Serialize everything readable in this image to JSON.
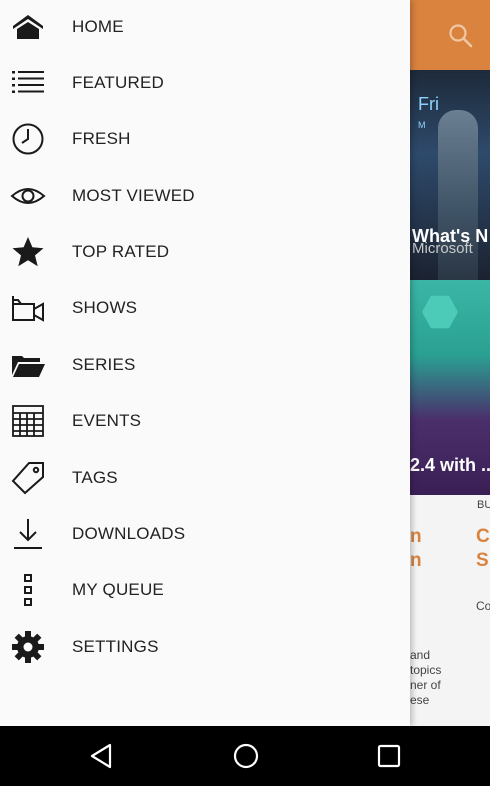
{
  "drawer": {
    "items": [
      {
        "label": "HOME",
        "icon": "home-icon"
      },
      {
        "label": "FEATURED",
        "icon": "list-icon"
      },
      {
        "label": "FRESH",
        "icon": "clock-icon"
      },
      {
        "label": "MOST VIEWED",
        "icon": "eye-icon"
      },
      {
        "label": "TOP RATED",
        "icon": "star-icon"
      },
      {
        "label": "SHOWS",
        "icon": "video-camera-icon"
      },
      {
        "label": "SERIES",
        "icon": "folder-icon"
      },
      {
        "label": "EVENTS",
        "icon": "calendar-grid-icon"
      },
      {
        "label": "TAGS",
        "icon": "tag-icon"
      },
      {
        "label": "DOWNLOADS",
        "icon": "download-icon"
      },
      {
        "label": "MY QUEUE",
        "icon": "queue-icon"
      },
      {
        "label": "SETTINGS",
        "icon": "gear-icon"
      }
    ]
  },
  "background": {
    "appbar_color": "#d9833f",
    "search_icon": "search-icon",
    "card1": {
      "title": "What's N",
      "subtitle": "Microsoft",
      "overlay_text": "Fri",
      "small_text": "M"
    },
    "card2": {
      "title": "2.4 with ..."
    },
    "card_meta": {
      "label_bu": "BU",
      "orange_1": "n",
      "orange_2": "n",
      "orange_3": "C",
      "orange_4": "S",
      "small_co": "Co"
    },
    "snippet": [
      "and",
      "topics",
      "ner of",
      "ese"
    ]
  },
  "system_nav": {
    "back": "back-icon",
    "home": "home-circle-icon",
    "recents": "recents-icon"
  }
}
